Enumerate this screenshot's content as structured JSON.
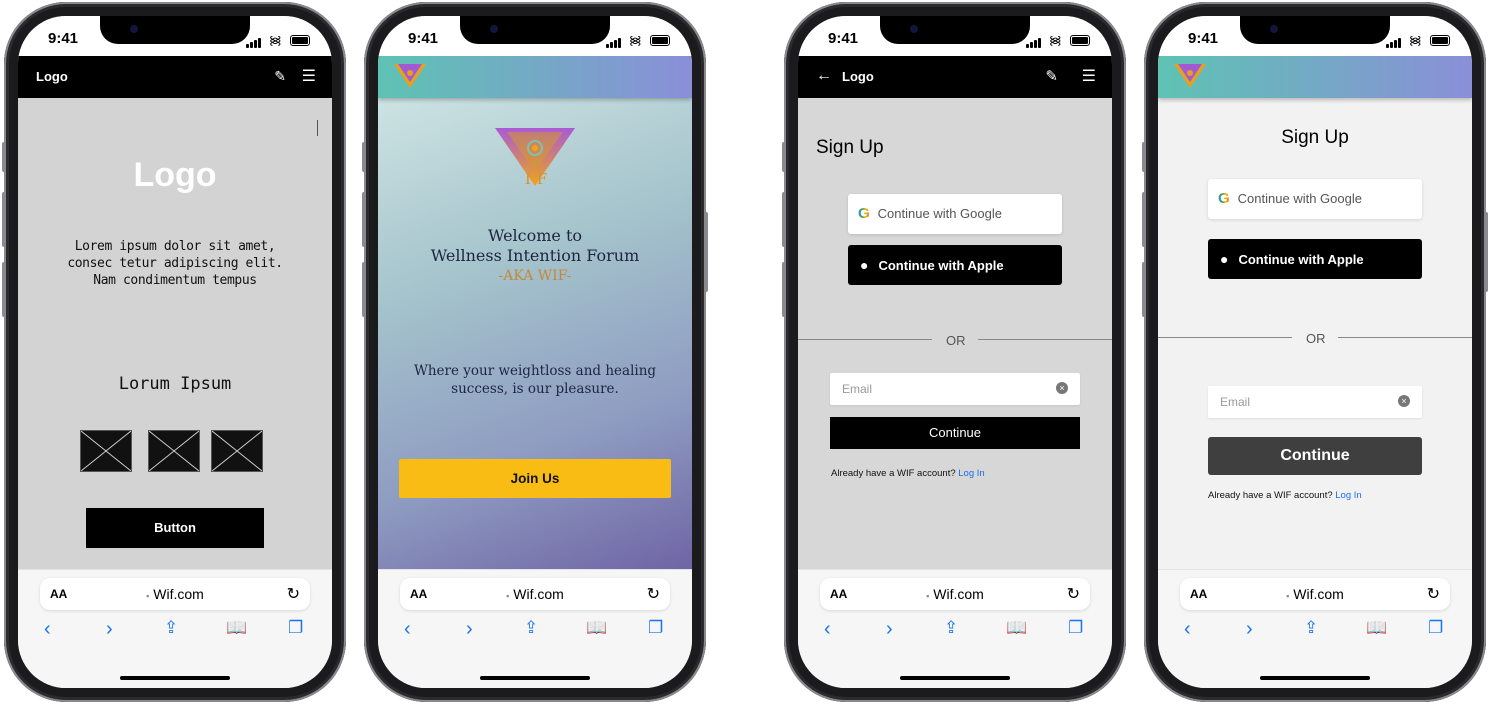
{
  "status": {
    "time": "9:41"
  },
  "safari": {
    "text_size": "AA",
    "url": "Wif.com",
    "lock": "🔒",
    "reload": "↻",
    "back": "‹",
    "forward": "›",
    "share": "⍐",
    "bookmarks": "📖",
    "tabs": "❐"
  },
  "phone1": {
    "nav_title": "Logo",
    "hero_logo": "Logo",
    "lorem_1": "Lorem ipsum dolor sit amet,",
    "lorem_2": "consec tetur adipiscing elit.",
    "lorem_3": "Nam condimentum tempus",
    "subtitle": "Lorum Ipsum",
    "button": "Button"
  },
  "phone2": {
    "logo_letters": "IF",
    "welcome_1": "Welcome to",
    "welcome_2": "Wellness Intention Forum",
    "aka": "-AKA WIF-",
    "tagline_1": "Where your weightloss and healing",
    "tagline_2": "success, is our pleasure.",
    "button": "Join Us"
  },
  "phone3": {
    "nav_title": "Logo",
    "title": "Sign Up",
    "google": "Continue with Google",
    "apple": "Continue with Apple",
    "or": "OR",
    "email_placeholder": "Email",
    "continue": "Continue",
    "already": "Already have a WIF account?",
    "login": "Log In"
  },
  "phone4": {
    "title": "Sign Up",
    "google": "Continue with Google",
    "apple": "Continue with Apple",
    "or": "OR",
    "email_placeholder": "Email",
    "continue": "Continue",
    "already": "Already have a WIF account?",
    "login": "Log In"
  },
  "colors": {
    "accent_yellow": "#f8bc14",
    "link_blue": "#1a6ef0",
    "safari_blue": "#1976f0",
    "gradient_start": "#5ec3b3",
    "gradient_end": "#8a8fd8"
  }
}
